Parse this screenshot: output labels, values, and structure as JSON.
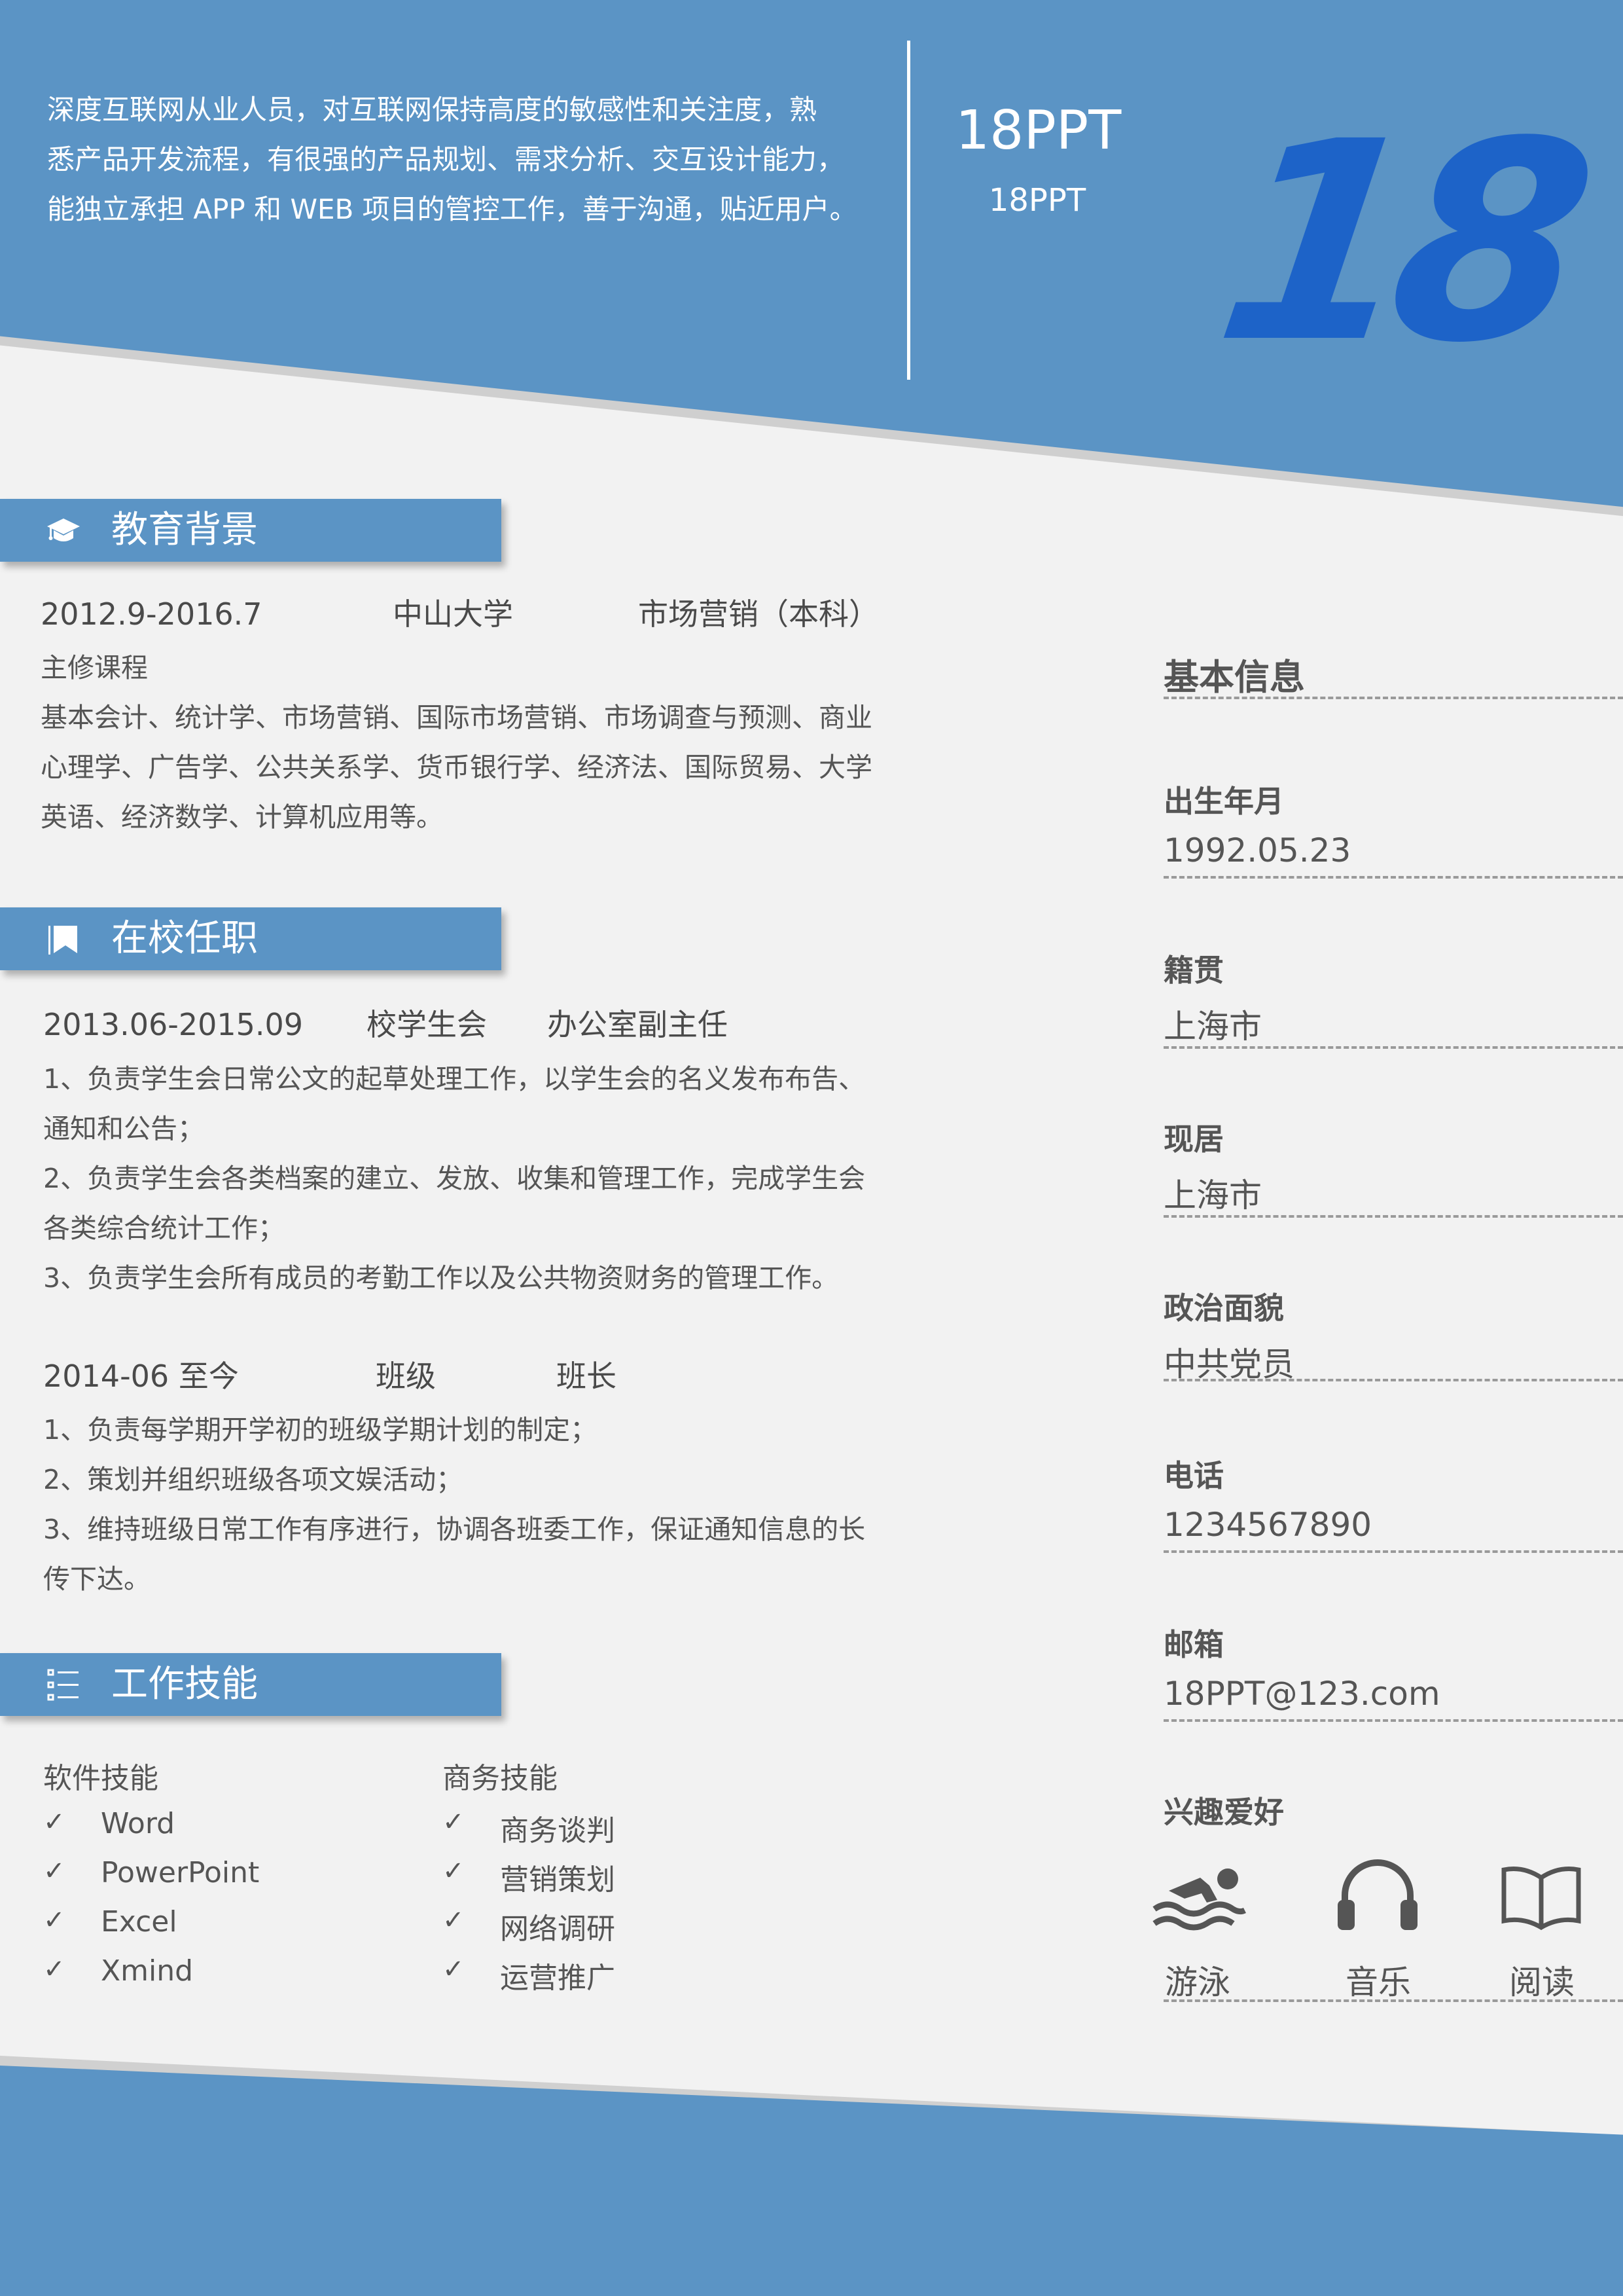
{
  "header": {
    "intro_lines": [
      "深度互联网从业人员，对互联网保持高度的敏感性和关注度，熟",
      "悉产品开发流程，有很强的产品规划、需求分析、交互设计能力，",
      "能独立承担 APP 和 WEB 项目的管控工作，善于沟通，贴近用户。"
    ],
    "name": "18PPT",
    "subtitle": "18PPT",
    "logo_text": "18",
    "logo_color": "#1d63c8",
    "accent_color": "#5b94c5"
  },
  "education": {
    "title": "教育背景",
    "icon": "graduation-cap-icon",
    "period": "2012.9-2016.7",
    "school": "中山大学",
    "major": "市场营销（本科）",
    "courses_label": "主修课程",
    "courses_lines": [
      "基本会计、统计学、市场营销、国际市场营销、市场调查与预测、商业",
      "心理学、广告学、公共关系学、货币银行学、经济法、国际贸易、大学",
      "英语、经济数学、计算机应用等。"
    ]
  },
  "campus": {
    "title": "在校任职",
    "icon": "bookmark-icon",
    "jobs": [
      {
        "period": "2013.06-2015.09",
        "org": "校学生会",
        "role": "办公室副主任",
        "lines": [
          "1、负责学生会日常公文的起草处理工作，以学生会的名义发布布告、",
          "通知和公告；",
          "2、负责学生会各类档案的建立、发放、收集和管理工作，完成学生会",
          "各类综合统计工作；",
          "3、负责学生会所有成员的考勤工作以及公共物资财务的管理工作。"
        ]
      },
      {
        "period": "2014-06 至今",
        "org": "班级",
        "role": "班长",
        "lines": [
          "1、负责每学期开学初的班级学期计划的制定；",
          "2、策划并组织班级各项文娱活动；",
          "3、维持班级日常工作有序进行，协调各班委工作，保证通知信息的长",
          "传下达。"
        ]
      }
    ]
  },
  "skills": {
    "title": "工作技能",
    "icon": "list-icon",
    "check_mark": "✓",
    "software": {
      "label": "软件技能",
      "items": [
        "Word",
        "PowerPoint",
        "Excel",
        "Xmind"
      ]
    },
    "business": {
      "label": "商务技能",
      "items": [
        "商务谈判",
        "营销策划",
        "网络调研",
        "运营推广"
      ]
    }
  },
  "info": {
    "title": "基本信息",
    "fields": [
      {
        "label": "出生年月",
        "value": "1992.05.23"
      },
      {
        "label": "籍贯",
        "value": "上海市"
      },
      {
        "label": "现居",
        "value": "上海市"
      },
      {
        "label": "政治面貌",
        "value": "中共党员"
      },
      {
        "label": "电话",
        "value": "1234567890"
      },
      {
        "label": "邮箱",
        "value": "18PPT@123.com"
      }
    ],
    "hobbies_label": "兴趣爱好",
    "hobbies": [
      {
        "label": "游泳",
        "icon": "swimmer-icon"
      },
      {
        "label": "音乐",
        "icon": "headphones-icon"
      },
      {
        "label": "阅读",
        "icon": "open-book-icon"
      }
    ]
  }
}
